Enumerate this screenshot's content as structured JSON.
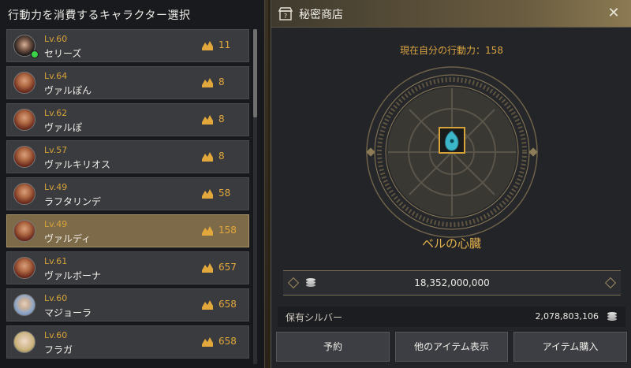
{
  "left_panel": {
    "title": "行動力を消費するキャラクター選択",
    "characters": [
      {
        "level": "Lv.60",
        "name": "セリーズ",
        "ap": "11"
      },
      {
        "level": "Lv.64",
        "name": "ヴァルぽん",
        "ap": "8"
      },
      {
        "level": "Lv.62",
        "name": "ヴァルぽ",
        "ap": "8"
      },
      {
        "level": "Lv.57",
        "name": "ヴァルキリオス",
        "ap": "8"
      },
      {
        "level": "Lv.49",
        "name": "ラフタリンデ",
        "ap": "58"
      },
      {
        "level": "Lv.49",
        "name": "ヴァルディ",
        "ap": "158"
      },
      {
        "level": "Lv.61",
        "name": "ヴァルボーナ",
        "ap": "657"
      },
      {
        "level": "Lv.60",
        "name": "マジョーラ",
        "ap": "658"
      },
      {
        "level": "Lv.60",
        "name": "フラガ",
        "ap": "658"
      }
    ],
    "selected_index": 5
  },
  "shop": {
    "title": "秘密商店",
    "current_ap_label": "現在自分の行動力：158",
    "item_name": "ベルの心臓",
    "price": "18,352,000,000",
    "silver_label": "保有シルバー",
    "silver_value": "2,078,803,106",
    "buttons": {
      "reserve": "予約",
      "other_items": "他のアイテム表示",
      "purchase": "アイテム購入"
    }
  },
  "colors": {
    "accent_gold": "#d9a441",
    "selected_row": "#7d6a48",
    "online": "#3bd24a"
  },
  "icons": [
    "energy-icon",
    "shop-icon",
    "close-icon",
    "silver-coin-icon",
    "gem-icon"
  ]
}
